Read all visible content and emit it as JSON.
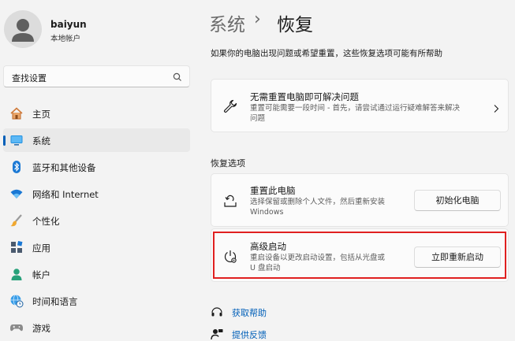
{
  "user": {
    "name": "baiyun",
    "account_type": "本地帐户"
  },
  "search": {
    "placeholder": "查找设置"
  },
  "sidebar": {
    "items": [
      {
        "label": "主页",
        "icon": "home-icon"
      },
      {
        "label": "系统",
        "icon": "system-icon",
        "selected": true
      },
      {
        "label": "蓝牙和其他设备",
        "icon": "bluetooth-icon"
      },
      {
        "label": "网络和 Internet",
        "icon": "wifi-icon"
      },
      {
        "label": "个性化",
        "icon": "brush-icon"
      },
      {
        "label": "应用",
        "icon": "apps-icon"
      },
      {
        "label": "帐户",
        "icon": "person-icon"
      },
      {
        "label": "时间和语言",
        "icon": "globe-clock-icon"
      },
      {
        "label": "游戏",
        "icon": "gamepad-icon"
      }
    ]
  },
  "breadcrumb": {
    "parent": "系统",
    "separator": "›",
    "current": "恢复"
  },
  "intro": "如果你的电脑出现问题或希望重置，这些恢复选项可能有所帮助",
  "fix_card": {
    "title": "无需重置电脑即可解决问题",
    "desc_line1": "重置可能需要一段时间 - 首先，请尝试通过运行疑难解答来解决",
    "desc_line2": "问题"
  },
  "section": {
    "title": "恢复选项"
  },
  "reset_card": {
    "title": "重置此电脑",
    "desc_line1": "选择保留或删除个人文件，然后重新安装",
    "desc_line2": "Windows",
    "button": "初始化电脑"
  },
  "advanced_card": {
    "title": "高级启动",
    "desc_line1": "重启设备以更改启动设置，包括从光盘或",
    "desc_line2": "U 盘启动",
    "button": "立即重新启动"
  },
  "links": {
    "help": "获取帮助",
    "feedback": "提供反馈"
  },
  "colors": {
    "accent": "#005fb8",
    "highlight_border": "#e02020",
    "background": "#f3f3f3"
  }
}
